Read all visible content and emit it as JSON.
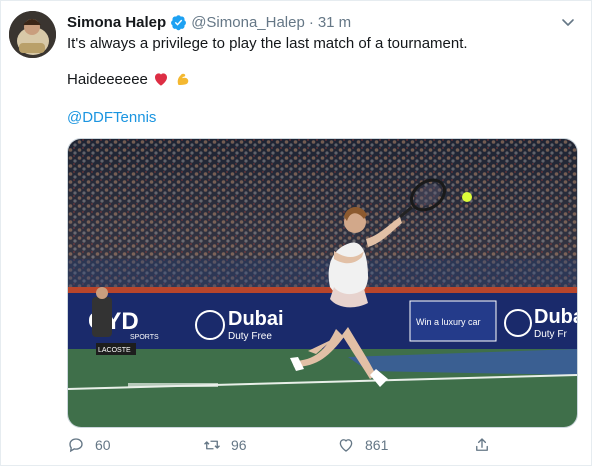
{
  "tweet": {
    "author_name": "Simona Halep",
    "author_handle": "@Simona_Halep",
    "separator": "·",
    "time": "31 m",
    "line1": "It's always a privilege to play the last match of a tournament.",
    "line2": "Haideeeeee",
    "mention": "@DDFTennis"
  },
  "media": {
    "banner_texts": [
      "Dubai",
      "Duty Free",
      "Win a luxury car",
      "Duba",
      "Duty Fr"
    ],
    "sign": "LACOSTE",
    "sponsor": "SPORTS"
  },
  "actions": {
    "replies": "60",
    "retweets": "96",
    "likes": "861"
  },
  "colors": {
    "link": "#1b95e0",
    "muted": "#657786",
    "verified": "#1da1f2",
    "court": "#3f6f4a"
  }
}
